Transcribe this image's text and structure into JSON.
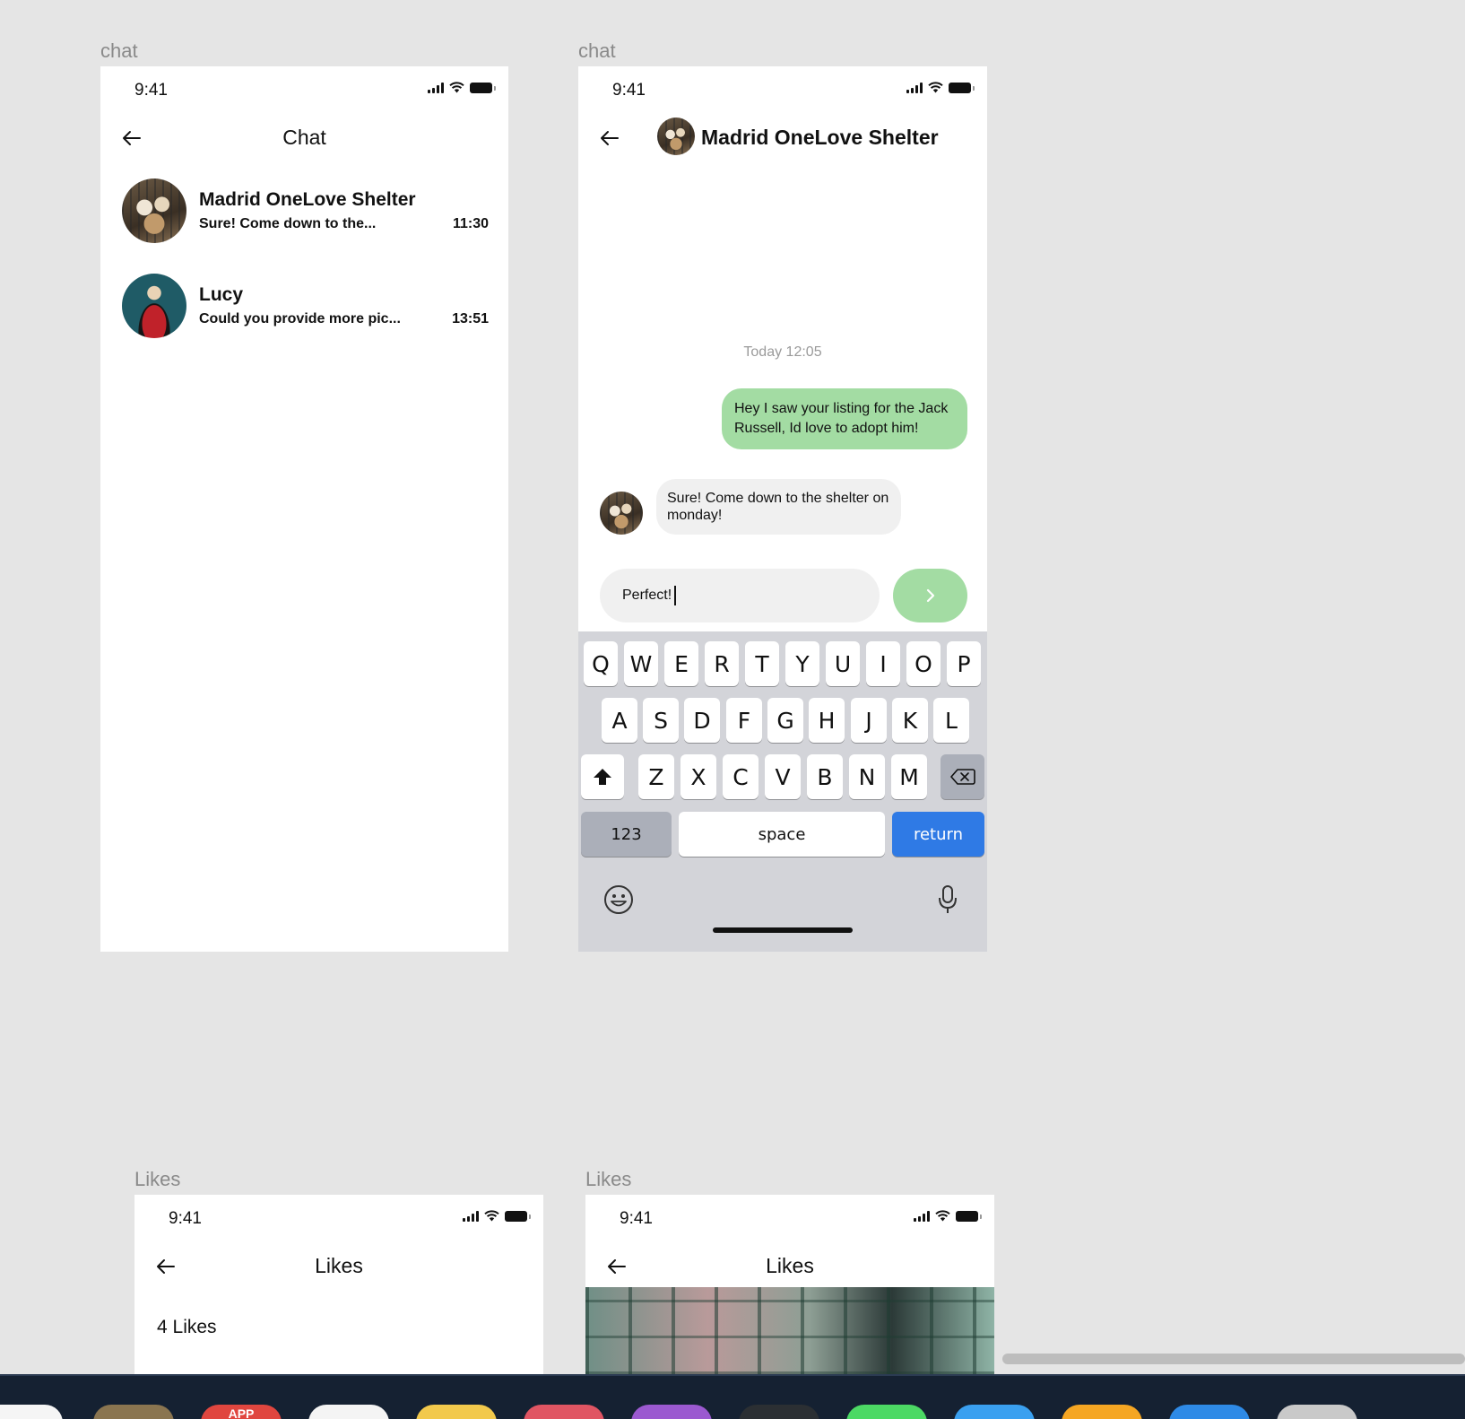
{
  "status": {
    "time": "9:41"
  },
  "frames": {
    "chat_list": {
      "label": "chat",
      "title": "Chat",
      "conversations": [
        {
          "name": "Madrid OneLove Shelter",
          "preview": "Sure! Come down to the...",
          "time": "11:30"
        },
        {
          "name": "Lucy",
          "preview": "Could you provide more pic...",
          "time": "13:51"
        }
      ]
    },
    "conversation": {
      "label": "chat",
      "title": "Madrid OneLove Shelter",
      "timestamp": "Today 12:05",
      "messages": [
        {
          "from": "me",
          "text": "Hey I saw your listing for the Jack Russell, Id love to adopt him!"
        },
        {
          "from": "them",
          "text": "Sure! Come down to the shelter on monday!"
        }
      ],
      "input_value": "Perfect!",
      "keyboard": {
        "row1": [
          "Q",
          "W",
          "E",
          "R",
          "T",
          "Y",
          "U",
          "I",
          "O",
          "P"
        ],
        "row2": [
          "A",
          "S",
          "D",
          "F",
          "G",
          "H",
          "J",
          "K",
          "L"
        ],
        "row3": [
          "Z",
          "X",
          "C",
          "V",
          "B",
          "N",
          "M"
        ],
        "numbers": "123",
        "space": "space",
        "return": "return"
      }
    },
    "likes_list": {
      "label": "Likes",
      "title": "Likes",
      "count": "4 Likes"
    },
    "likes_detail": {
      "label": "Likes",
      "title": "Likes"
    }
  },
  "dock": {
    "app_badge": "APP"
  },
  "colors": {
    "bubble_outgoing": "#a3dca3",
    "bubble_incoming": "#f0f0f0",
    "return_key": "#2f7ae5",
    "canvas": "#e5e5e5",
    "dock": "#152132"
  }
}
